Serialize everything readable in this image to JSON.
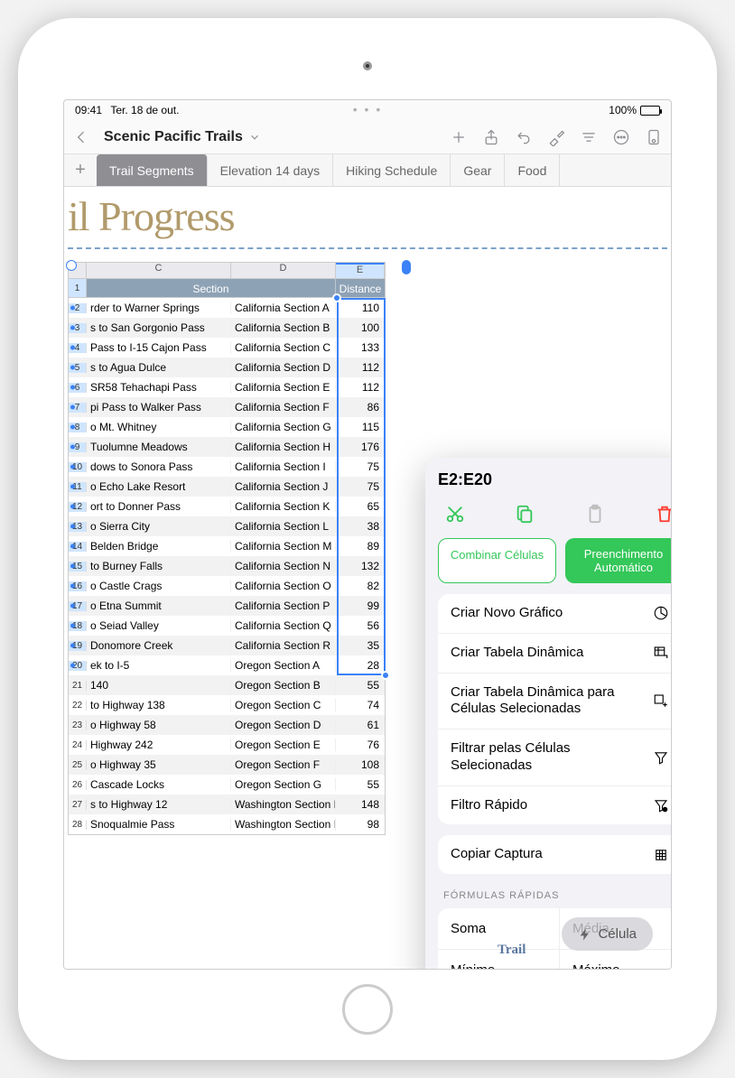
{
  "status": {
    "time": "09:41",
    "date": "Ter. 18 de out.",
    "battery_pct": "100%"
  },
  "document": {
    "title": "Scenic Pacific Trails"
  },
  "tabs": [
    {
      "label": "Trail Segments",
      "active": true
    },
    {
      "label": "Elevation 14 days",
      "active": false
    },
    {
      "label": "Hiking Schedule",
      "active": false
    },
    {
      "label": "Gear",
      "active": false
    },
    {
      "label": "Food",
      "active": false
    }
  ],
  "heading_partial": "il Progress",
  "columns": {
    "c": "C",
    "d": "D",
    "e": "E"
  },
  "table_header": {
    "row_num": "1",
    "section": "Section",
    "distance": "Distance"
  },
  "rows": [
    {
      "n": "2",
      "c": "rder to Warner Springs",
      "d": "California Section A",
      "e": "110",
      "sel": true
    },
    {
      "n": "3",
      "c": "s to San Gorgonio Pass",
      "d": "California Section B",
      "e": "100",
      "sel": true
    },
    {
      "n": "4",
      "c": "Pass to I-15 Cajon Pass",
      "d": "California Section C",
      "e": "133",
      "sel": true
    },
    {
      "n": "5",
      "c": "s to Agua Dulce",
      "d": "California Section D",
      "e": "112",
      "sel": true
    },
    {
      "n": "6",
      "c": "SR58 Tehachapi Pass",
      "d": "California Section E",
      "e": "112",
      "sel": true
    },
    {
      "n": "7",
      "c": "pi Pass to Walker Pass",
      "d": "California Section F",
      "e": "86",
      "sel": true
    },
    {
      "n": "8",
      "c": "o Mt. Whitney",
      "d": "California Section G",
      "e": "115",
      "sel": true
    },
    {
      "n": "9",
      "c": "Tuolumne Meadows",
      "d": "California Section H",
      "e": "176",
      "sel": true
    },
    {
      "n": "10",
      "c": "dows to Sonora Pass",
      "d": "California Section I",
      "e": "75",
      "sel": true
    },
    {
      "n": "11",
      "c": "o Echo Lake Resort",
      "d": "California Section J",
      "e": "75",
      "sel": true
    },
    {
      "n": "12",
      "c": "ort to Donner Pass",
      "d": "California Section K",
      "e": "65",
      "sel": true
    },
    {
      "n": "13",
      "c": "o Sierra City",
      "d": "California Section L",
      "e": "38",
      "sel": true
    },
    {
      "n": "14",
      "c": "Belden Bridge",
      "d": "California Section M",
      "e": "89",
      "sel": true
    },
    {
      "n": "15",
      "c": "to Burney Falls",
      "d": "California Section N",
      "e": "132",
      "sel": true
    },
    {
      "n": "16",
      "c": "o Castle Crags",
      "d": "California Section O",
      "e": "82",
      "sel": true
    },
    {
      "n": "17",
      "c": "o Etna Summit",
      "d": "California Section P",
      "e": "99",
      "sel": true
    },
    {
      "n": "18",
      "c": "o Seiad Valley",
      "d": "California Section Q",
      "e": "56",
      "sel": true
    },
    {
      "n": "19",
      "c": "Donomore Creek",
      "d": "California Section R",
      "e": "35",
      "sel": true
    },
    {
      "n": "20",
      "c": "ek to I-5",
      "d": "Oregon Section A",
      "e": "28",
      "sel": true
    },
    {
      "n": "21",
      "c": "140",
      "d": "Oregon Section B",
      "e": "55",
      "sel": false
    },
    {
      "n": "22",
      "c": "to Highway 138",
      "d": "Oregon Section C",
      "e": "74",
      "sel": false
    },
    {
      "n": "23",
      "c": "o Highway 58",
      "d": "Oregon Section D",
      "e": "61",
      "sel": false
    },
    {
      "n": "24",
      "c": "Highway 242",
      "d": "Oregon Section E",
      "e": "76",
      "sel": false
    },
    {
      "n": "25",
      "c": "o Highway 35",
      "d": "Oregon Section F",
      "e": "108",
      "sel": false
    },
    {
      "n": "26",
      "c": "Cascade Locks",
      "d": "Oregon Section G",
      "e": "55",
      "sel": false
    },
    {
      "n": "27",
      "c": "s to Highway 12",
      "d": "Washington Section H",
      "e": "148",
      "sel": false
    },
    {
      "n": "28",
      "c": "Snoqualmie Pass",
      "d": "Washington Section I",
      "e": "98",
      "sel": false
    }
  ],
  "popover": {
    "range_ref": "E2:E20",
    "combine": "Combinar Células",
    "autofill": "Preenchimento Automático",
    "menu": {
      "new_chart": "Criar Novo Gráfico",
      "pivot": "Criar Tabela Dinâmica",
      "pivot_selected": "Criar Tabela Dinâmica para Células Selecionadas",
      "filter_selected": "Filtrar pelas Células Selecionadas",
      "quick_filter": "Filtro Rápido",
      "copy_snapshot": "Copiar Captura"
    },
    "formulas_label": "FÓRMULAS RÁPIDAS",
    "formulas": {
      "sum": "Soma",
      "avg": "Média",
      "min": "Mínimo",
      "max": "Máximo"
    }
  },
  "fab": {
    "label": "Célula"
  },
  "footer_word": "Trail"
}
